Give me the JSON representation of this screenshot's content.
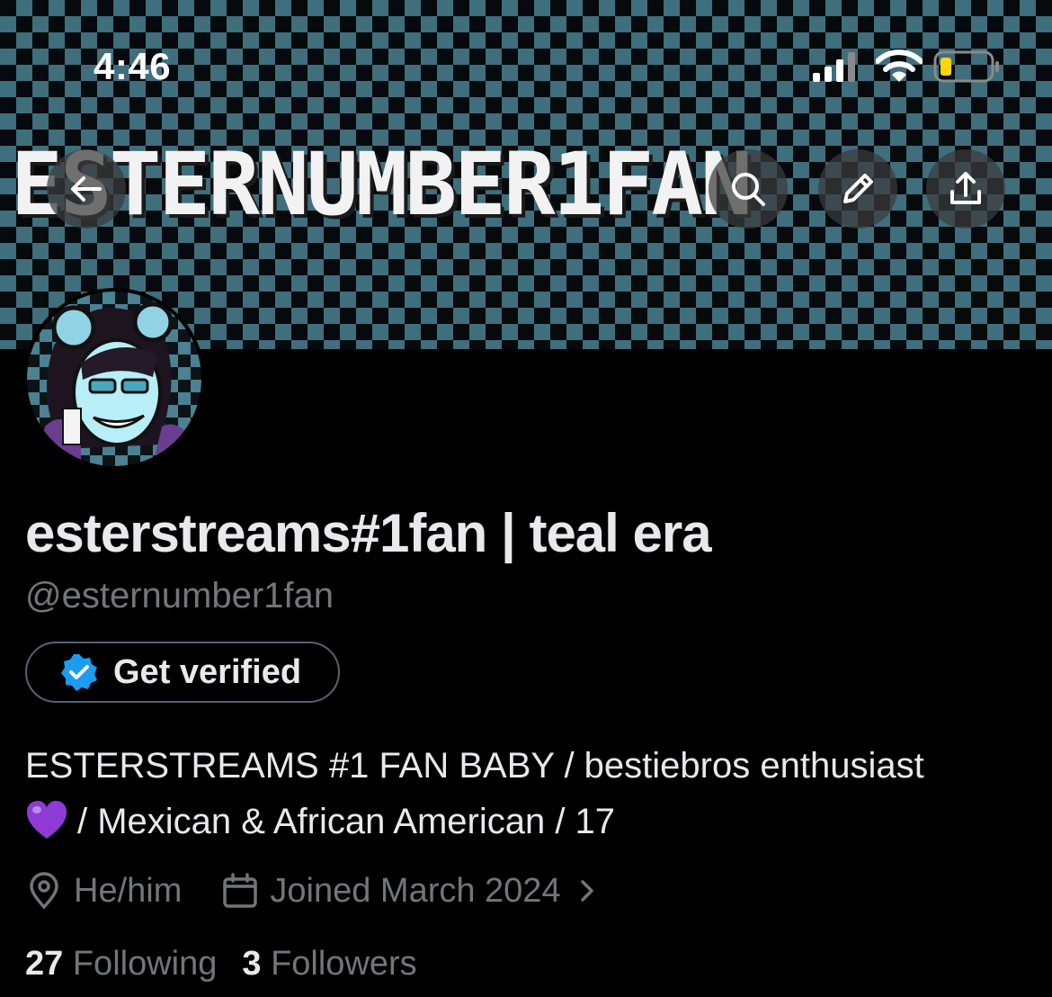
{
  "status_bar": {
    "time": "4:46"
  },
  "banner": {
    "text": "ESTERNUMBER1FAN"
  },
  "nav": {
    "back_icon": "arrow-left-icon",
    "search_icon": "search-icon",
    "edit_icon": "pencil-icon",
    "share_icon": "share-icon"
  },
  "profile": {
    "display_name": "esterstreams#1fan | teal era",
    "handle": "@esternumber1fan",
    "verify_label": "Get verified",
    "bio_line1": "ESTERSTREAMS #1 FAN BABY / bestiebros enthusiast",
    "bio_line2": "/ Mexican & African American / 17",
    "pronouns": "He/him",
    "joined": "Joined March 2024",
    "following_count": "27",
    "following_label": "Following",
    "followers_count": "3",
    "followers_label": "Followers"
  },
  "colors": {
    "banner_teal": "#3f6e7d",
    "verified_blue": "#1d9bf0",
    "heart_purple": "#8e3bd6",
    "muted": "#71767b"
  }
}
